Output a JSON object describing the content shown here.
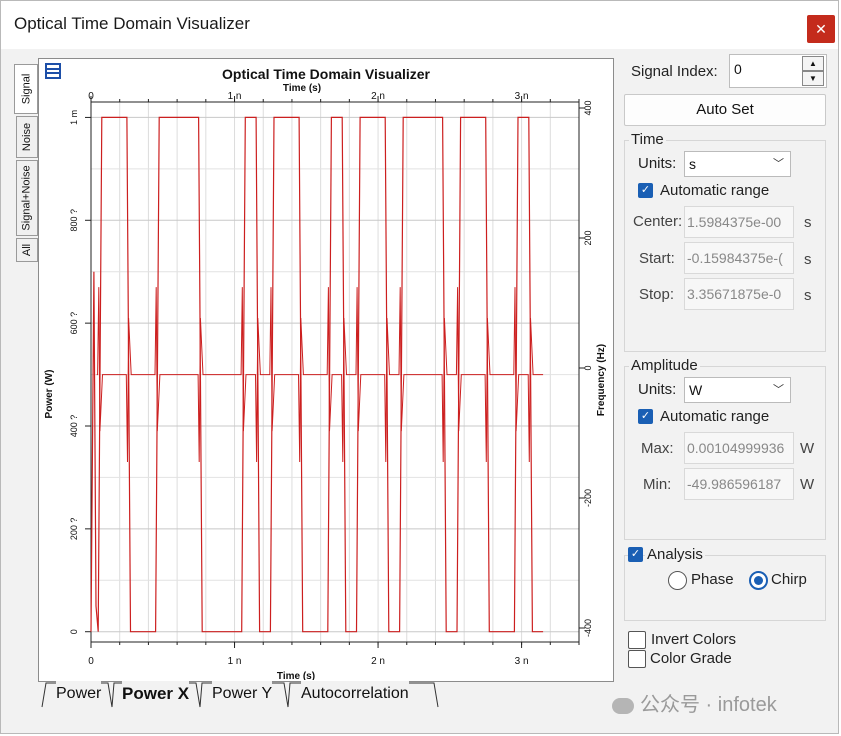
{
  "window": {
    "title": "Optical Time Domain Visualizer",
    "close_glyph": "✕"
  },
  "side_tabs": [
    "Signal",
    "Noise",
    "Signal+Noise",
    "All"
  ],
  "chart_data": {
    "type": "line",
    "title": "Optical Time Domain Visualizer",
    "xlabel_top": "Time (s)",
    "xlabel": "Time (s)",
    "ylabel": "Power (W)",
    "y2label": "Frequency (Hz)",
    "x_ticks": [
      "0",
      "1 n",
      "2 n",
      "3 n"
    ],
    "x_tick_values": [
      0,
      1,
      2,
      3
    ],
    "y_ticks": [
      "0",
      "200 ?",
      "400 ?",
      "600 ?",
      "800 ?",
      "1 m"
    ],
    "y_tick_values": [
      0,
      200,
      400,
      600,
      800,
      1000
    ],
    "y2_ticks": [
      "-400",
      "-200",
      "0",
      "200",
      "400"
    ],
    "y2_tick_values": [
      -400,
      -200,
      0,
      200,
      400
    ],
    "xlim": [
      0,
      3.4
    ],
    "ylim": [
      -20,
      1030
    ],
    "y2lim": [
      -400,
      400
    ],
    "grid": true,
    "series_color": "#cc1f1f",
    "bit_period_ns": 0.1,
    "bits_start_ns": 0.05,
    "bits": [
      1,
      1,
      0,
      0,
      1,
      1,
      1,
      0,
      0,
      0,
      1,
      0,
      1,
      1,
      0,
      0,
      1,
      0,
      1,
      1,
      0,
      1,
      1,
      1,
      0,
      1,
      1,
      0,
      0,
      1,
      0
    ],
    "power_high": 1000,
    "power_low": 0,
    "chirp_rest": 500,
    "chirp_spike_high": 670,
    "chirp_spike_low": 330
  },
  "bottom_tabs": [
    "Power",
    "Power X",
    "Power Y",
    "Autocorrelation"
  ],
  "panel": {
    "signal_index_label": "Signal Index:",
    "signal_index_value": "0",
    "auto_set": "Auto Set",
    "time": {
      "title": "Time",
      "units_label": "Units:",
      "units_value": "s",
      "auto_range": "Automatic range",
      "center_label": "Center:",
      "center_value": "1.5984375e-00",
      "start_label": "Start:",
      "start_value": "-0.15984375e-(",
      "stop_label": "Stop:",
      "stop_value": "3.35671875e-0",
      "unit_suffix": "s"
    },
    "amplitude": {
      "title": "Amplitude",
      "units_label": "Units:",
      "units_value": "W",
      "auto_range": "Automatic range",
      "max_label": "Max:",
      "max_value": "0.00104999936",
      "min_label": "Min:",
      "min_value": "-49.986596187",
      "unit_suffix": "W"
    },
    "analysis": {
      "title": "Analysis",
      "phase": "Phase",
      "chirp": "Chirp",
      "selected": "Chirp"
    },
    "invert_colors": "Invert Colors",
    "color_grade": "Color Grade"
  },
  "watermark": "公众号 · infotek",
  "colors": {
    "accent": "#1a5fb4",
    "close": "#c42b1c",
    "trace": "#cc1f1f"
  }
}
